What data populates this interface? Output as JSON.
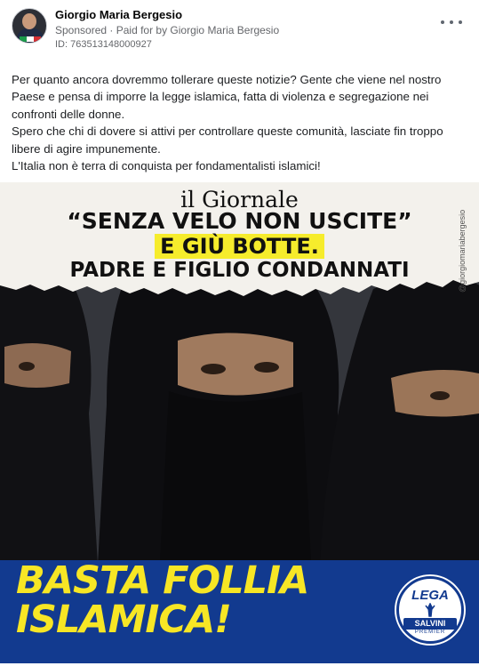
{
  "post": {
    "page_name": "Giorgio Maria Bergesio",
    "sponsored_label": "Sponsored",
    "separator": " · ",
    "paid_for_prefix": "Paid for by ",
    "paid_for_name": "Giorgio Maria Bergesio",
    "ad_id": "ID: 763513148000927",
    "more_icon": "more-horizontal-icon",
    "body": [
      "Per quanto ancora dovremmo tollerare queste notizie? Gente che viene nel nostro Paese e pensa di imporre la legge islamica, fatta di violenza e segregazione nei confronti delle donne.",
      "Spero che chi di dovere si attivi per controllare queste comunità, lasciate fin troppo libere di agire impunemente.",
      "L'Italia non è terra di conquista per fondamentalisti islamici!"
    ]
  },
  "ad_image": {
    "newspaper": "il Giornale",
    "headline_1": "“SENZA VELO NON USCITE”",
    "headline_2": "E GIÙ BOTTE.",
    "headline_3": "PADRE E FIGLIO CONDANNATI",
    "handle": "@giorgiomariabergesio",
    "banner_line_1": "BASTA FOLLIA",
    "banner_line_2": "ISLAMICA!",
    "logo": {
      "word": "LEGA",
      "name": "SALVINI",
      "sub": "PREMIER"
    }
  },
  "colors": {
    "highlight_yellow": "#f6ec2c",
    "banner_blue": "#123a8f",
    "banner_text_yellow": "#f7e625",
    "meta_gray": "#65676b"
  }
}
